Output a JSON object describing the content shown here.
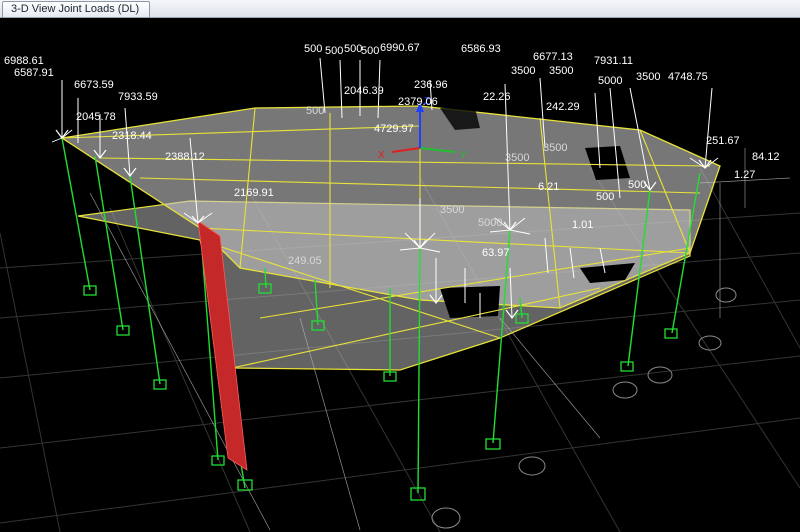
{
  "window": {
    "tab_title": "3-D View  Joint Loads (DL)"
  },
  "colors": {
    "background": "#000000",
    "grid": "#3a3a3a",
    "slab_fill": "#b4b4b4",
    "beam": "#e8e23a",
    "column": "#22dd33",
    "load_arrow": "#ffffff",
    "wall": "#cc2a2a",
    "axis_x": "#e02020",
    "axis_y": "#20c030",
    "axis_z": "#2040ff"
  },
  "axes": {
    "x_label": "X",
    "y_label": "Y",
    "z_label": "Z"
  },
  "joint_load_labels": [
    "6988.61",
    "6587.91",
    "6673.59",
    "2045.78",
    "7933.59",
    "2318.44",
    "2388.12",
    "500",
    "500",
    "500",
    "500",
    "6990.67",
    "6586.93",
    "6677.13",
    "3500",
    "3500",
    "7931.11",
    "5000",
    "3500",
    "4748.75",
    "2046.39",
    "236.96",
    "2379.06",
    "22.26",
    "4729.97",
    "242.29",
    "251.67",
    "84.12",
    "1.27",
    "2169.91",
    "3500",
    "3500",
    "3500",
    "6.21",
    "500",
    "500",
    "1.01",
    "249.05",
    "63.97",
    "5000",
    "500"
  ]
}
